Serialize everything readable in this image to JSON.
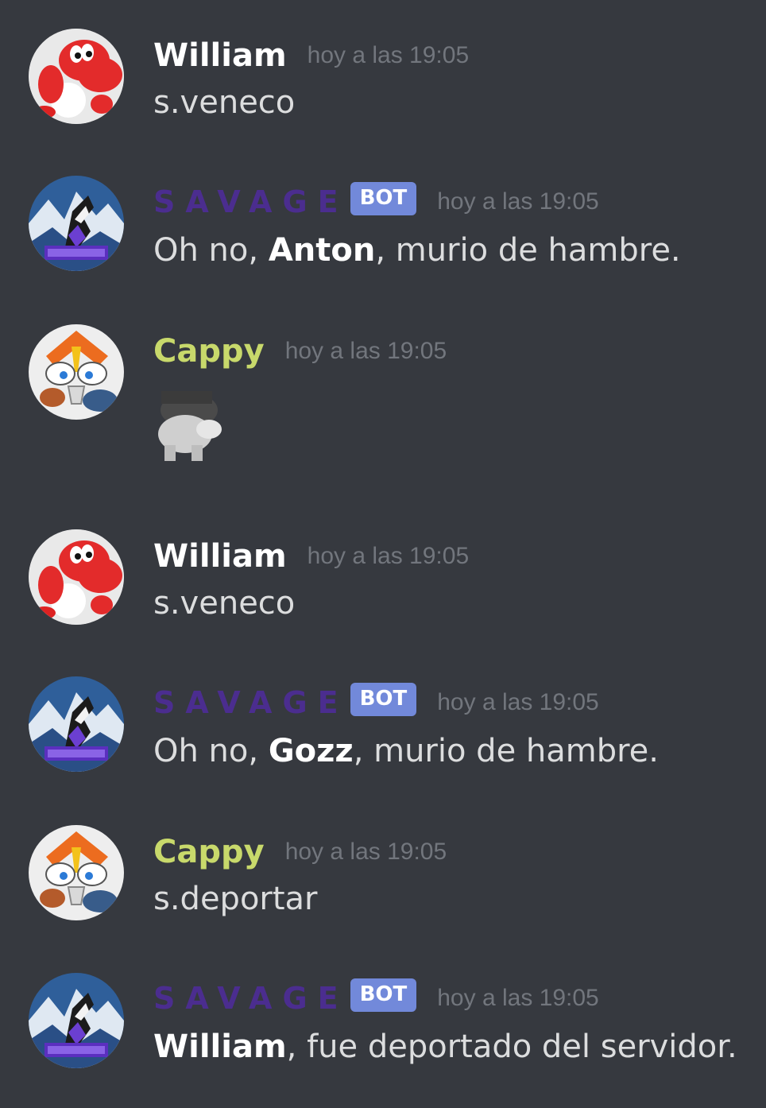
{
  "colors": {
    "background": "#36393f",
    "william": "#ffffff",
    "savage": "#4b2d8f",
    "cappy": "#c8d96b",
    "bot_tag": "#7289da",
    "timestamp": "#72767d",
    "text": "#dcddde"
  },
  "messages": [
    {
      "author": "William",
      "avatar": "red-yoshi-avatar",
      "timestamp": "hoy a las 19:05",
      "text": "s.veneco"
    },
    {
      "author": "SAVAGE",
      "bot_label": "BOT",
      "avatar": "wolf-avatar",
      "timestamp": "hoy a las 19:05",
      "text_prefix": "Oh no, ",
      "text_bold": "Anton",
      "text_suffix": ", murio de hambre."
    },
    {
      "author": "Cappy",
      "avatar": "pokemon-avatar",
      "timestamp": "hoy a las 19:05",
      "attachment": "sticker-icon"
    },
    {
      "author": "William",
      "avatar": "red-yoshi-avatar",
      "timestamp": "hoy a las 19:05",
      "text": "s.veneco"
    },
    {
      "author": "SAVAGE",
      "bot_label": "BOT",
      "avatar": "wolf-avatar",
      "timestamp": "hoy a las 19:05",
      "text_prefix": "Oh no, ",
      "text_bold": "Gozz",
      "text_suffix": ", murio de hambre."
    },
    {
      "author": "Cappy",
      "avatar": "pokemon-avatar",
      "timestamp": "hoy a las 19:05",
      "text": "s.deportar"
    },
    {
      "author": "SAVAGE",
      "bot_label": "BOT",
      "avatar": "wolf-avatar",
      "timestamp": "hoy a las 19:05",
      "text_bold": "William",
      "text_suffix": ", fue deportado del servidor."
    }
  ]
}
